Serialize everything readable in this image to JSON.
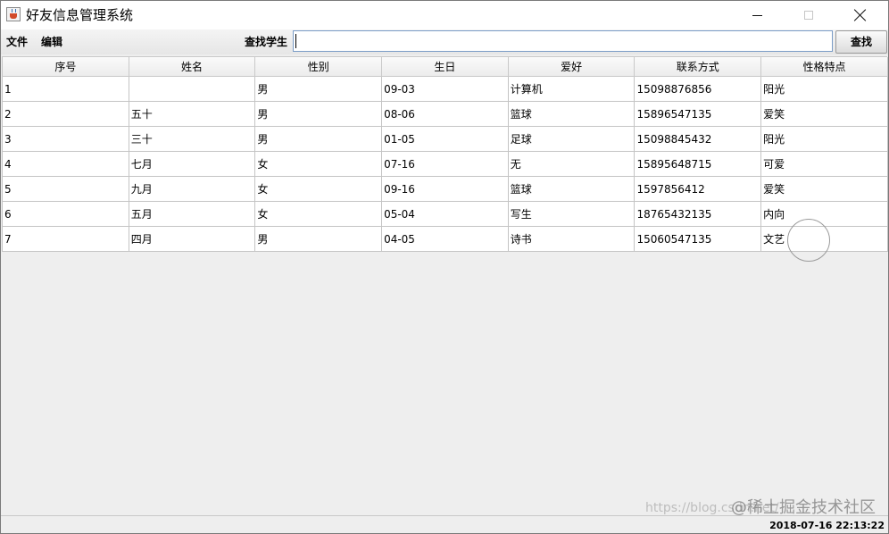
{
  "window": {
    "title": "好友信息管理系统",
    "icon": "java-cup-icon",
    "controls": [
      "minimize",
      "maximize",
      "close"
    ]
  },
  "menubar": {
    "file": "文件",
    "edit": "编辑",
    "search_label": "查找学生",
    "search_value": "",
    "search_button": "查找"
  },
  "table": {
    "columns": [
      "序号",
      "姓名",
      "性别",
      "生日",
      "爱好",
      "联系方式",
      "性格特点"
    ],
    "rows": [
      [
        "1",
        "",
        "男",
        "09-03",
        "计算机",
        "15098876856",
        "阳光"
      ],
      [
        "2",
        "五十",
        "男",
        "08-06",
        "篮球",
        "15896547135",
        "爱笑"
      ],
      [
        "3",
        "三十",
        "男",
        "01-05",
        "足球",
        "15098845432",
        "阳光"
      ],
      [
        "4",
        "七月",
        "女",
        "07-16",
        "无",
        "15895648715",
        "可爱"
      ],
      [
        "5",
        "九月",
        "女",
        "09-16",
        "篮球",
        "1597856412",
        "爱笑"
      ],
      [
        "6",
        "五月",
        "女",
        "05-04",
        "写生",
        "18765432135",
        "内向"
      ],
      [
        "7",
        "四月",
        "男",
        "04-05",
        "诗书",
        "15060547135",
        "文艺"
      ]
    ]
  },
  "watermark": {
    "url": "https://blog.csdn.net/",
    "brand": "@稀土掘金技术社区"
  },
  "status": {
    "datetime": "2018-07-16 22:13:22"
  }
}
